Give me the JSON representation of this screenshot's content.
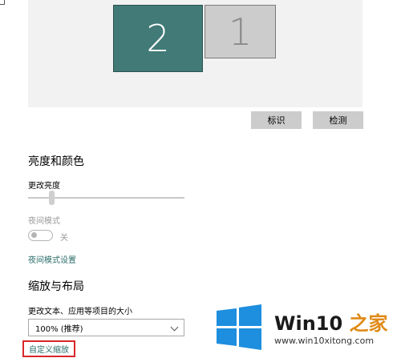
{
  "display": {
    "monitor_2_label": "2",
    "monitor_1_label": "1",
    "identify_label": "标识",
    "detect_label": "检测"
  },
  "brightness_section": {
    "heading": "亮度和颜色",
    "brightness_label": "更改亮度",
    "brightness_level_percent": 15,
    "night_mode_label": "夜间模式",
    "night_mode_state": "关",
    "night_mode_settings_link": "夜间模式设置"
  },
  "scale_section": {
    "heading": "缩放与布局",
    "text_size_label": "更改文本、应用等项目的大小",
    "text_size_value": "100% (推荐)",
    "custom_scale_link": "自定义缩放"
  },
  "watermark": {
    "brand_prefix": "Win10",
    "brand_suffix": "之家",
    "url": "www.win10xitong.com"
  },
  "colors": {
    "accent": "#2b6e6a",
    "monitor_selected": "#417a77",
    "highlight_border": "#d9262b",
    "windows_blue": "#1e8ede"
  }
}
